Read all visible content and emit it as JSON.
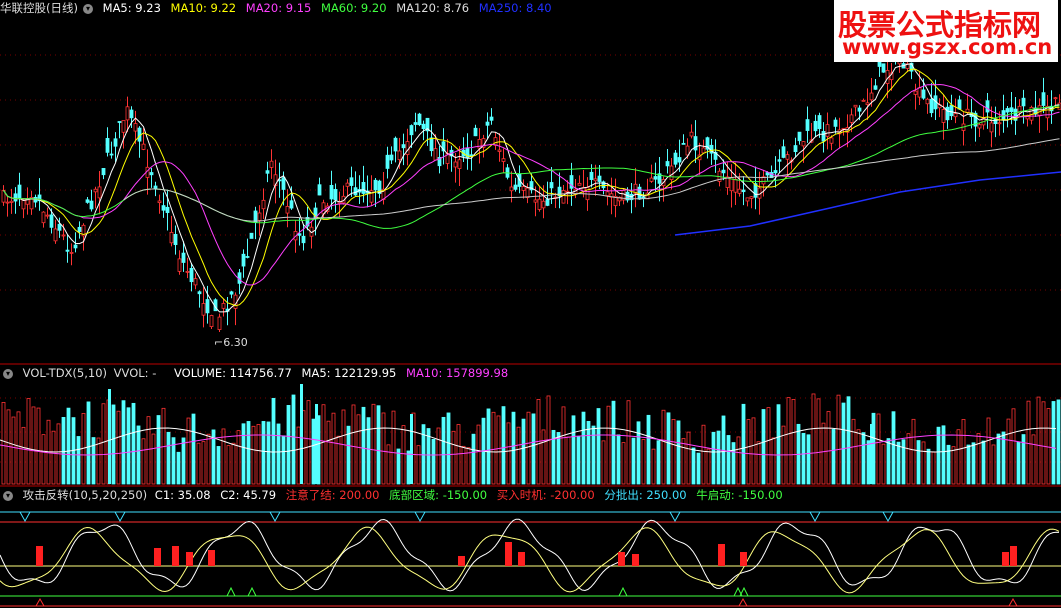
{
  "main": {
    "stock_label": "华联控股(日线)",
    "ma": [
      {
        "label": "MA5: 9.23",
        "color": "#ffffff"
      },
      {
        "label": "MA10: 9.22",
        "color": "#ffff00"
      },
      {
        "label": "MA20: 9.15",
        "color": "#ff40ff"
      },
      {
        "label": "MA60: 9.20",
        "color": "#40ff40"
      },
      {
        "label": "MA120: 8.76",
        "color": "#dddddd"
      },
      {
        "label": "MA250: 8.40",
        "color": "#2030ff"
      }
    ],
    "low_label": "6.30"
  },
  "volume": {
    "name": "VOL-TDX(5,10)",
    "vvol": "VVOL: -",
    "items": [
      {
        "label": "VOLUME: 114756.77",
        "color": "#ffffff"
      },
      {
        "label": "MA5: 122129.95",
        "color": "#ffffff"
      },
      {
        "label": "MA10: 157899.98",
        "color": "#ff40ff"
      }
    ]
  },
  "indicator": {
    "name": "攻击反转(10,5,20,250)",
    "items": [
      {
        "label": "C1: 35.08",
        "color": "#ffffff"
      },
      {
        "label": "C2: 45.79",
        "color": "#ffffff"
      },
      {
        "label": "注意了结: 200.00",
        "color": "#ff3030"
      },
      {
        "label": "底部区域: -150.00",
        "color": "#40ff40"
      },
      {
        "label": "买入时机: -200.00",
        "color": "#ff3030"
      },
      {
        "label": "分批出: 250.00",
        "color": "#40e0ff"
      },
      {
        "label": "牛启动: -150.00",
        "color": "#40ff40"
      }
    ]
  },
  "watermark": {
    "title": "股票公式指标网",
    "url": "www.gszx.com.cn"
  },
  "chart_data": {
    "type": "candlestick",
    "price_low_marker": 6.3,
    "ma_values": {
      "MA5": 9.23,
      "MA10": 9.22,
      "MA20": 9.15,
      "MA60": 9.2,
      "MA120": 8.76,
      "MA250": 8.4
    },
    "volume_values": {
      "VOLUME": 114756.77,
      "MA5": 122129.95,
      "MA10": 157899.98
    },
    "indicator_values": {
      "C1": 35.08,
      "C2": 45.79,
      "注意了结": 200.0,
      "底部区域": -150.0,
      "买入时机": -200.0,
      "分批出": 250.0,
      "牛启动": -150.0
    }
  }
}
